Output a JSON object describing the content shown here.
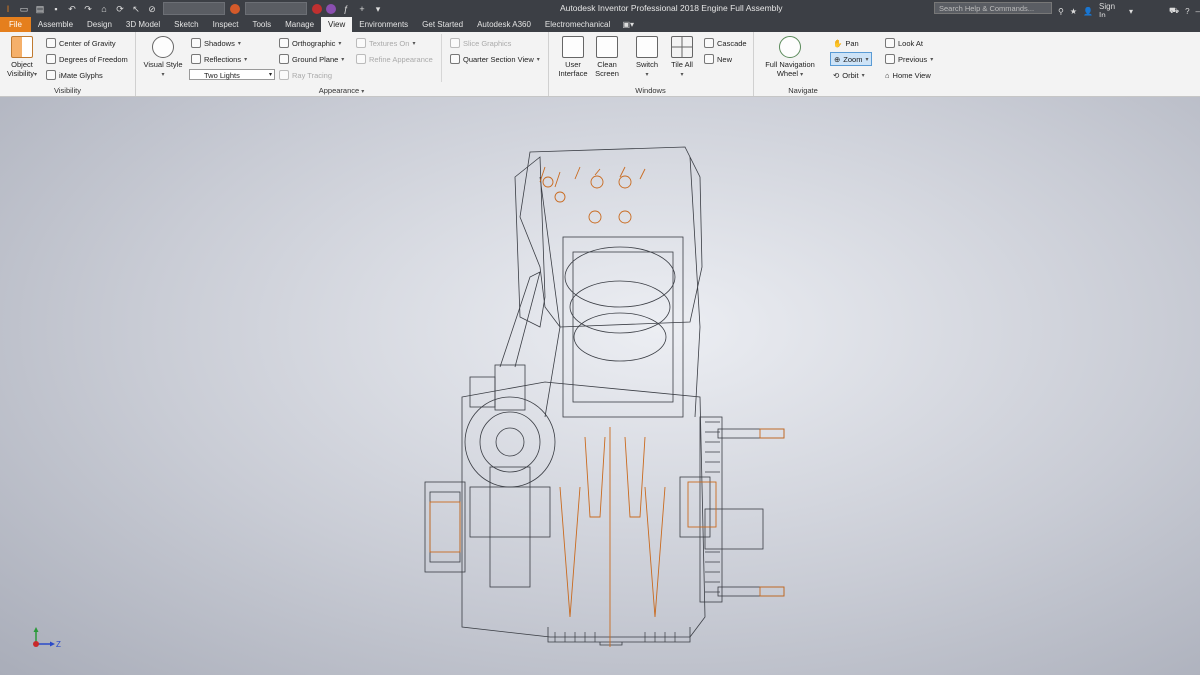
{
  "app": {
    "title": "Autodesk Inventor Professional 2018   Engine Full Assembly"
  },
  "search": {
    "placeholder": "Search Help & Commands..."
  },
  "account": {
    "sign_in": "Sign In"
  },
  "menu_tabs": [
    "File",
    "Assemble",
    "Design",
    "3D Model",
    "Sketch",
    "Inspect",
    "Tools",
    "Manage",
    "View",
    "Environments",
    "Get Started",
    "Autodesk A360",
    "Electromechanical"
  ],
  "active_tab": "View",
  "ribbon": {
    "visibility": {
      "label": "Visibility",
      "object_visibility": "Object Visibility",
      "center_of_gravity": "Center of Gravity",
      "degrees_of_freedom": "Degrees of Freedom",
      "imate_glyphs": "iMate Glyphs"
    },
    "appearance": {
      "label": "Appearance",
      "visual_style": "Visual Style",
      "shadows": "Shadows",
      "reflections": "Reflections",
      "lighting": "Two Lights",
      "orthographic": "Orthographic",
      "ground_plane": "Ground Plane",
      "ray_tracing": "Ray Tracing",
      "textures_on": "Textures On",
      "refine_appearance": "Refine Appearance",
      "slice_graphics": "Slice Graphics",
      "quarter_section_view": "Quarter Section View"
    },
    "windows": {
      "label": "Windows",
      "user_interface": "User Interface",
      "clean_screen": "Clean Screen",
      "switch": "Switch",
      "tile_all": "Tile All",
      "cascade": "Cascade",
      "new": "New"
    },
    "navigate": {
      "label": "Navigate",
      "full_navigation_wheel": "Full Navigation Wheel",
      "pan": "Pan",
      "zoom": "Zoom",
      "orbit": "Orbit",
      "look_at": "Look At",
      "previous": "Previous",
      "home_view": "Home View"
    }
  },
  "triad": {
    "z_label": "Z"
  },
  "colors": {
    "accent": "#e57f1d",
    "wire": "#3a3d44",
    "highlight": "#c96a1f"
  }
}
